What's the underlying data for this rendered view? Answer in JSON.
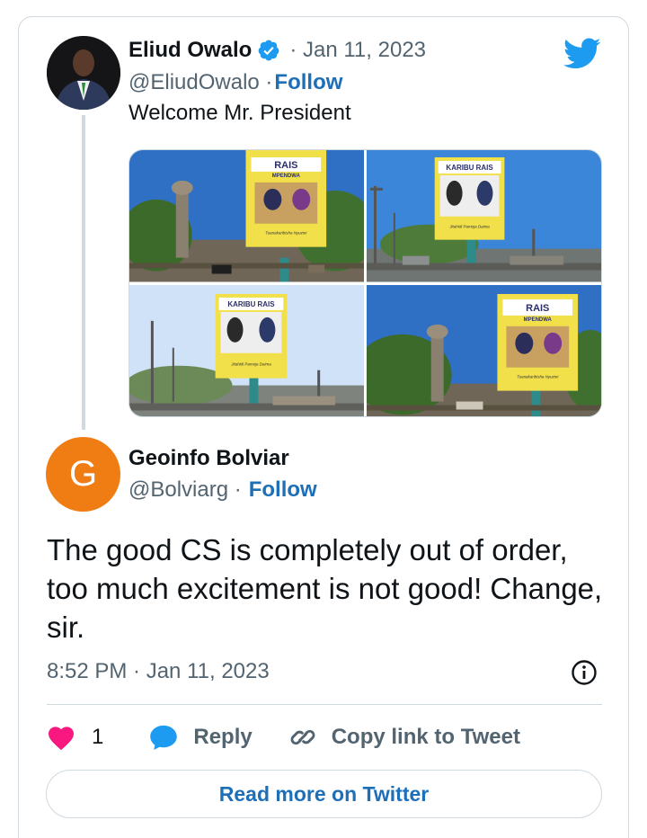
{
  "parent_tweet": {
    "author_name": "Eliud Owalo",
    "date": "· Jan 11, 2023",
    "handle": "@EliudOwalo ·",
    "follow_label": "Follow",
    "text": "Welcome Mr. President",
    "images": [
      {
        "billboard_title": "RAIS",
        "billboard_subtitle": "MPENDWA",
        "billboard_tagline": "Tuanakaribisha Nyuzini"
      },
      {
        "billboard_title": "KARIBU RAIS",
        "billboard_subtitle": "",
        "billboard_tagline": "Jitahidi Pamoja Daima"
      },
      {
        "billboard_title": "KARIBU RAIS",
        "billboard_subtitle": "",
        "billboard_tagline": "Jitahidi Pamoja Daima"
      },
      {
        "billboard_title": "RAIS",
        "billboard_subtitle": "MPENDWA",
        "billboard_tagline": "Tuanakaribisha Nyuzini"
      }
    ]
  },
  "reply_tweet": {
    "avatar_letter": "G",
    "author_name": "Geoinfo Bolviar",
    "handle": "@Bolviarg ·",
    "follow_label": "Follow",
    "text": "The good CS is completely out of order, too much excitement is not good! Change, sir.",
    "timestamp": "8:52 PM · Jan 11, 2023"
  },
  "actions": {
    "like_count": "1",
    "reply_label": "Reply",
    "copy_label": "Copy link to Tweet"
  },
  "read_more_label": "Read more on Twitter",
  "colors": {
    "link": "#1d6fb8",
    "secondary_text": "#536471",
    "twitter_blue": "#1d9bf0",
    "like_pink": "#f91880",
    "avatar_orange": "#ef7d14",
    "border": "#cfd9de"
  }
}
